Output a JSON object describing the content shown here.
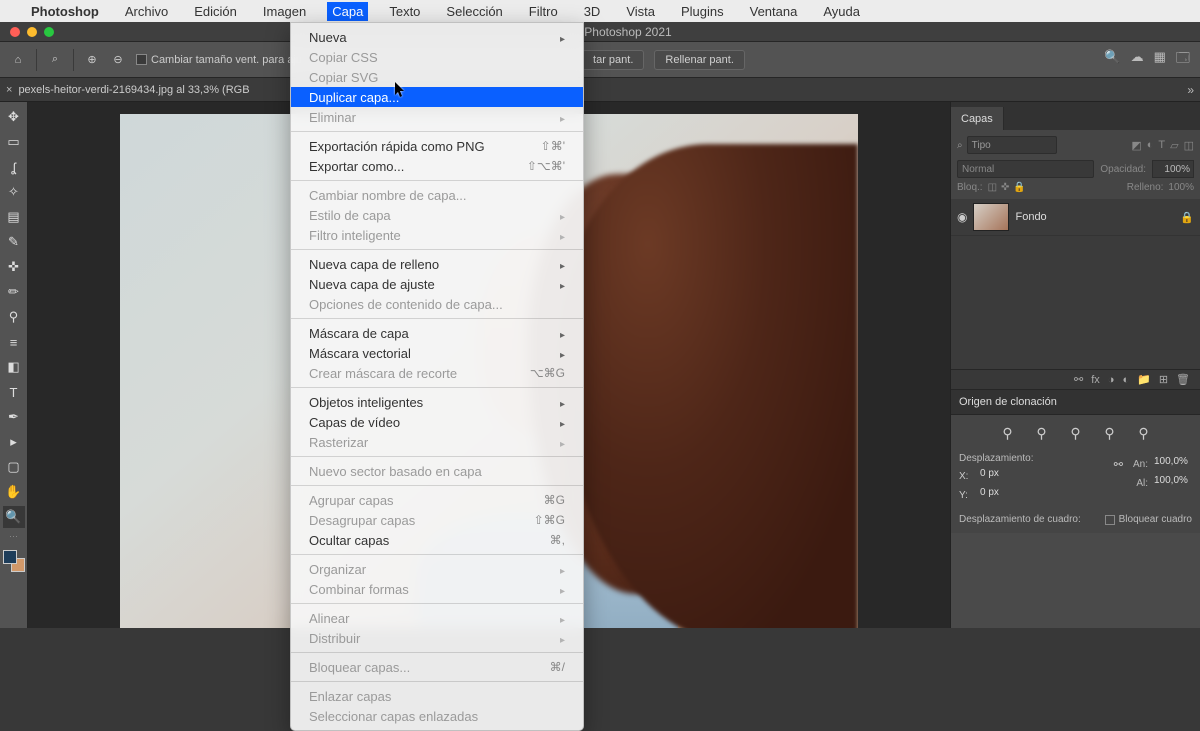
{
  "mac_menu": {
    "apple": "",
    "app": "Photoshop",
    "items": [
      "Archivo",
      "Edición",
      "Imagen",
      "Capa",
      "Texto",
      "Selección",
      "Filtro",
      "3D",
      "Vista",
      "Plugins",
      "Ventana",
      "Ayuda"
    ],
    "active_index": 3
  },
  "window_title": "Photoshop 2021",
  "options_bar": {
    "resize_checkbox": "Cambiar tamaño vent. para aju",
    "btn_fit": "tar pant.",
    "btn_fill": "Rellenar pant."
  },
  "document_tab": {
    "close": "×",
    "title": "pexels-heitor-verdi-2169434.jpg al 33,3% (RGB"
  },
  "dropdown": {
    "groups": [
      [
        {
          "label": "Nueva",
          "arrow": true
        },
        {
          "label": "Copiar CSS",
          "disabled": true
        },
        {
          "label": "Copiar SVG",
          "disabled": true
        },
        {
          "label": "Duplicar capa...",
          "selected": true
        },
        {
          "label": "Eliminar",
          "disabled": true,
          "arrow": true
        }
      ],
      [
        {
          "label": "Exportación rápida como PNG",
          "shortcut": "⇧⌘'"
        },
        {
          "label": "Exportar como...",
          "shortcut": "⇧⌥⌘'"
        }
      ],
      [
        {
          "label": "Cambiar nombre de capa...",
          "disabled": true
        },
        {
          "label": "Estilo de capa",
          "disabled": true,
          "arrow": true
        },
        {
          "label": "Filtro inteligente",
          "disabled": true,
          "arrow": true
        }
      ],
      [
        {
          "label": "Nueva capa de relleno",
          "arrow": true
        },
        {
          "label": "Nueva capa de ajuste",
          "arrow": true
        },
        {
          "label": "Opciones de contenido de capa...",
          "disabled": true
        }
      ],
      [
        {
          "label": "Máscara de capa",
          "arrow": true
        },
        {
          "label": "Máscara vectorial",
          "arrow": true
        },
        {
          "label": "Crear máscara de recorte",
          "disabled": true,
          "shortcut": "⌥⌘G"
        }
      ],
      [
        {
          "label": "Objetos inteligentes",
          "arrow": true
        },
        {
          "label": "Capas de vídeo",
          "arrow": true
        },
        {
          "label": "Rasterizar",
          "disabled": true,
          "arrow": true
        }
      ],
      [
        {
          "label": "Nuevo sector basado en capa",
          "disabled": true
        }
      ],
      [
        {
          "label": "Agrupar capas",
          "disabled": true,
          "shortcut": "⌘G"
        },
        {
          "label": "Desagrupar capas",
          "disabled": true,
          "shortcut": "⇧⌘G"
        },
        {
          "label": "Ocultar capas",
          "shortcut": "⌘,"
        }
      ],
      [
        {
          "label": "Organizar",
          "disabled": true,
          "arrow": true
        },
        {
          "label": "Combinar formas",
          "disabled": true,
          "arrow": true
        }
      ],
      [
        {
          "label": "Alinear",
          "disabled": true,
          "arrow": true
        },
        {
          "label": "Distribuir",
          "disabled": true,
          "arrow": true
        }
      ],
      [
        {
          "label": "Bloquear capas...",
          "disabled": true,
          "shortcut": "⌘/"
        }
      ],
      [
        {
          "label": "Enlazar capas",
          "disabled": true
        },
        {
          "label": "Seleccionar capas enlazadas",
          "disabled": true
        }
      ]
    ]
  },
  "layers_panel": {
    "title": "Capas",
    "search_placeholder": "Tipo",
    "blend_mode": "Normal",
    "opacity_label": "Opacidad:",
    "opacity_value": "100%",
    "lock_label": "Bloq.:",
    "fill_label": "Relleno:",
    "fill_value": "100%",
    "layers": [
      {
        "name": "Fondo",
        "locked": true
      }
    ]
  },
  "clone_panel": {
    "title": "Origen de clonación",
    "offset_label": "Desplazamiento:",
    "x_label": "X:",
    "x_value": "0 px",
    "y_label": "Y:",
    "y_value": "0 px",
    "w_label": "An:",
    "w_value": "100,0%",
    "h_label": "Al:",
    "h_value": "100,0%",
    "frame_offset_label": "Desplazamiento de cuadro:",
    "frame_lock": "Bloquear cuadro"
  },
  "icon": {
    "search": "⌕",
    "home": "⌂",
    "zoomin": "⊕",
    "zoomout": "⊖",
    "user": "◐",
    "cloud": "☁",
    "grid": "▦",
    "frame": "▭",
    "eye": "👁",
    "trash": "🗑",
    "folder": "📁",
    "mask": "◑",
    "fx": "fx",
    "link": "⚯",
    "new": "⊞",
    "lock": "🔒",
    "stamp": "✥"
  }
}
